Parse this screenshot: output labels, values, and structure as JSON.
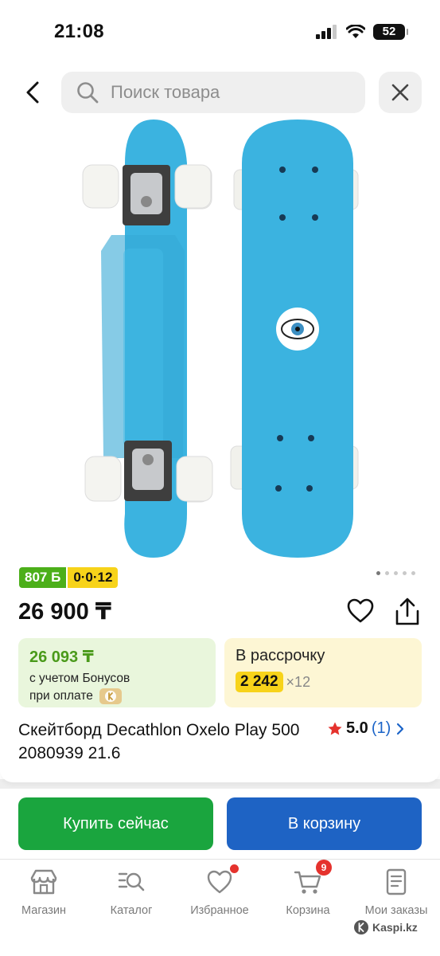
{
  "status": {
    "time": "21:08",
    "battery": "52"
  },
  "search": {
    "placeholder": "Поиск товара"
  },
  "product": {
    "badges": {
      "bonus": "807 Б",
      "installment": "0·0·12"
    },
    "price": "26 900 ₸",
    "bonus_card": {
      "price": "26 093 ₸",
      "line1": "с учетом Бонусов",
      "line2": "при оплате"
    },
    "installment_card": {
      "title": "В рассрочку",
      "amount": "2 242",
      "months": "×12"
    },
    "title": "Скейтборд Decathlon Oxelo Play 500 2080939 21.6",
    "rating": {
      "value": "5.0",
      "count": "(1)"
    },
    "image_pages": 5,
    "active_image": 0,
    "colors": {
      "board": "#3bb3e0",
      "wheels": "#f2f2ee"
    }
  },
  "actions": {
    "buy": "Купить сейчас",
    "cart": "В корзину"
  },
  "tabs": [
    {
      "label": "Магазин",
      "icon": "store-icon"
    },
    {
      "label": "Каталог",
      "icon": "catalog-search-icon"
    },
    {
      "label": "Избранное",
      "icon": "heart-icon"
    },
    {
      "label": "Корзина",
      "icon": "cart-icon",
      "badge": "9"
    },
    {
      "label": "Мои заказы",
      "icon": "orders-icon"
    }
  ],
  "watermark": "Kaspi.kz",
  "theme": {
    "green": "#1aa53e",
    "blue": "#1e63c4",
    "yellow": "#f7d31a",
    "red": "#e5322d"
  }
}
